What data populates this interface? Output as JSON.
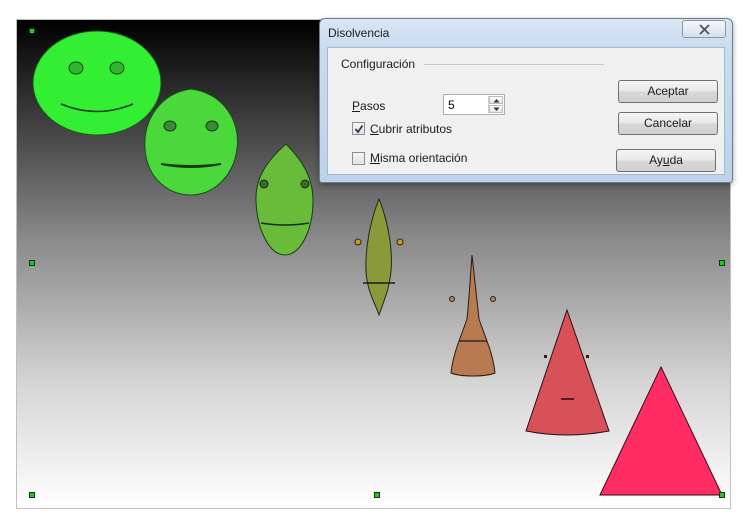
{
  "dialog": {
    "title": "Disolvencia",
    "group_label": "Configuración",
    "pasos_label": "Pasos",
    "pasos_value": "5",
    "cubrir_label": "Cubrir atributos",
    "cubrir_checked": true,
    "misma_label": "Misma orientación",
    "misma_checked": false,
    "accept_label": "Aceptar",
    "cancel_label": "Cancelar",
    "help_label": "Ayuda"
  },
  "icons": {
    "close": "close-icon",
    "check": "checkmark-icon",
    "spin_up": "chevron-up-icon",
    "spin_down": "chevron-down-icon"
  },
  "colors": {
    "start_shape": "#33ee33",
    "end_shape": "#ff2d64",
    "selection_handle": "#23c428"
  },
  "morph": {
    "steps": 5,
    "start_shape": "smiley face",
    "end_shape": "triangle"
  }
}
